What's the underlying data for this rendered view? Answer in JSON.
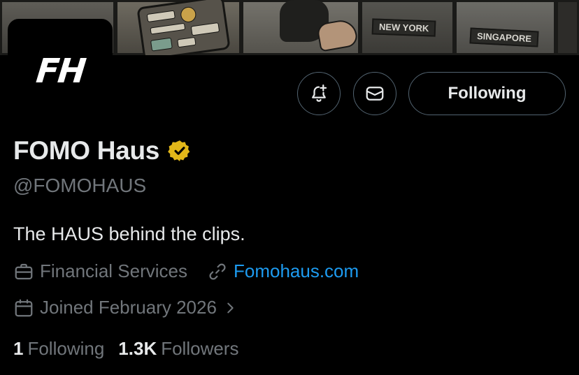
{
  "banner": {
    "city_1": "NEW YORK",
    "city_2": "SINGAPORE"
  },
  "avatar": {
    "logo_text": "FH"
  },
  "actions": {
    "notify_icon": "bell-plus-icon",
    "message_icon": "envelope-icon",
    "following_label": "Following"
  },
  "profile": {
    "display_name": "FOMO Haus",
    "verified_badge": "gold-verified-badge-icon",
    "handle": "@FOMOHAUS",
    "bio": "The HAUS behind the clips.",
    "category": "Financial Services",
    "website": "Fomohaus.com",
    "joined": "Joined February 2026"
  },
  "stats": {
    "following_count": "1",
    "following_label": "Following",
    "followers_count": "1.3K",
    "followers_label": "Followers"
  },
  "colors": {
    "background": "#000000",
    "text_primary": "#e7e9ea",
    "text_secondary": "#71767b",
    "link": "#1d9bf0",
    "verified_gold": "#e2b719",
    "button_border": "#536471"
  }
}
